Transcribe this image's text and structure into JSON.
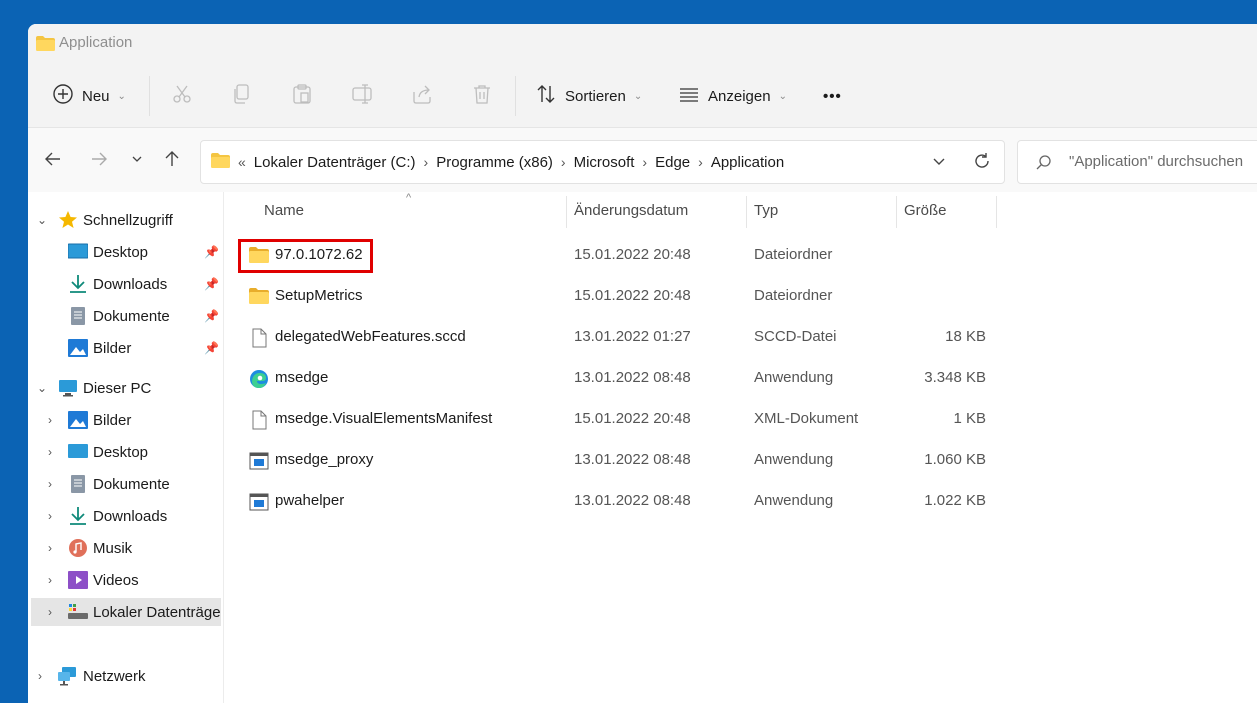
{
  "window": {
    "title": "Application"
  },
  "toolbar": {
    "new_label": "Neu",
    "sort_label": "Sortieren",
    "view_label": "Anzeigen",
    "more_label": "•••"
  },
  "address": {
    "overflow": "«",
    "crumbs": [
      "Lokaler Datenträger (C:)",
      "Programme (x86)",
      "Microsoft",
      "Edge",
      "Application"
    ]
  },
  "search": {
    "placeholder": "\"Application\" durchsuchen"
  },
  "sidebar": {
    "quick_access": {
      "label": "Schnellzugriff",
      "items": [
        {
          "label": "Desktop",
          "icon": "desktop-icon"
        },
        {
          "label": "Downloads",
          "icon": "download-icon"
        },
        {
          "label": "Dokumente",
          "icon": "document-icon"
        },
        {
          "label": "Bilder",
          "icon": "pictures-icon"
        }
      ]
    },
    "this_pc": {
      "label": "Dieser PC",
      "items": [
        {
          "label": "Bilder",
          "icon": "pictures-icon"
        },
        {
          "label": "Desktop",
          "icon": "desktop-icon"
        },
        {
          "label": "Dokumente",
          "icon": "document-icon"
        },
        {
          "label": "Downloads",
          "icon": "download-icon"
        },
        {
          "label": "Musik",
          "icon": "music-icon"
        },
        {
          "label": "Videos",
          "icon": "videos-icon"
        },
        {
          "label": "Lokaler Datenträger (C:)",
          "icon": "drive-icon",
          "selected": true
        }
      ]
    },
    "network": {
      "label": "Netzwerk"
    }
  },
  "columns": {
    "name": "Name",
    "date": "Änderungsdatum",
    "type": "Typ",
    "size": "Größe"
  },
  "files": [
    {
      "name": "97.0.1072.62",
      "date": "15.01.2022 20:48",
      "type": "Dateiordner",
      "size": "",
      "icon": "folder-icon",
      "highlighted": true
    },
    {
      "name": "SetupMetrics",
      "date": "15.01.2022 20:48",
      "type": "Dateiordner",
      "size": "",
      "icon": "folder-icon"
    },
    {
      "name": "delegatedWebFeatures.sccd",
      "date": "13.01.2022 01:27",
      "type": "SCCD-Datei",
      "size": "18 KB",
      "icon": "file-icon"
    },
    {
      "name": "msedge",
      "date": "13.01.2022 08:48",
      "type": "Anwendung",
      "size": "3.348 KB",
      "icon": "edge-icon"
    },
    {
      "name": "msedge.VisualElementsManifest",
      "date": "15.01.2022 20:48",
      "type": "XML-Dokument",
      "size": "1 KB",
      "icon": "file-icon"
    },
    {
      "name": "msedge_proxy",
      "date": "13.01.2022 08:48",
      "type": "Anwendung",
      "size": "1.060 KB",
      "icon": "app-icon"
    },
    {
      "name": "pwahelper",
      "date": "13.01.2022 08:48",
      "type": "Anwendung",
      "size": "1.022 KB",
      "icon": "app-icon"
    }
  ],
  "colors": {
    "desktop_bg": "#0b63b4",
    "highlight_box": "#e00000",
    "folder": "#f4c542"
  }
}
